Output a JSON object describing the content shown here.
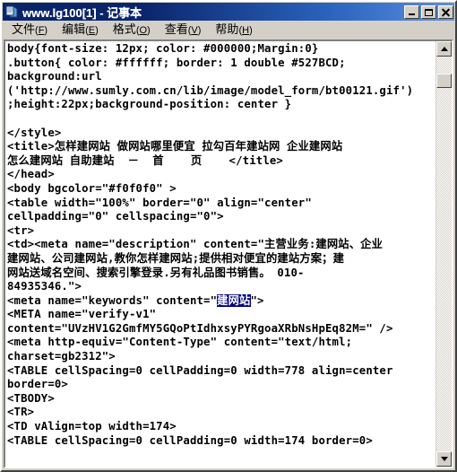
{
  "window": {
    "title": "www.lg100[1] - 记事本",
    "icon": "notepad-icon",
    "minimize_label": "最小化",
    "maximize_label": "最大化",
    "close_label": "关闭"
  },
  "menu": {
    "items": [
      {
        "label": "文件",
        "accel": "F"
      },
      {
        "label": "编辑",
        "accel": "E"
      },
      {
        "label": "格式",
        "accel": "O"
      },
      {
        "label": "查看",
        "accel": "V"
      },
      {
        "label": "帮助",
        "accel": "H"
      }
    ]
  },
  "editor": {
    "text_before_selection": "body{font-size: 12px; color: #000000;Margin:0}\n.button{ color: #ffffff; border: 1 double #527BCD;\nbackground:url\n('http://www.sumly.com.cn/lib/image/model_form/bt00121.gif')\n;height:22px;background-position: center }\n\n</style>\n<title>怎样建网站 做网站哪里便宜 拉勾百年建站网 企业建网站\n怎么建网站 自助建站  －  首    页    </title>\n</head>\n<body bgcolor=\"#f0f0f0\" >\n<table width=\"100%\" border=\"0\" align=\"center\"\ncellpadding=\"0\" cellspacing=\"0\">\n<tr>\n<td><meta name=\"description\" content=\"主营业务:建网站、企业\n建网站、公司建网站,教你怎样建网站;提供相对便宜的建站方案；建\n网站送域名空间、搜索引擎登录.另有礼品图书销售。 010-\n84935346.\">\n<meta name=\"keywords\" content=\"",
    "selected_text": "建网站",
    "text_after_selection": "\">\n<META name=\"verify-v1\"\ncontent=\"UVzHV1G2GmfMY5GQoPtIdhxsyPYRgoaXRbNsHpEq82M=\" />\n<meta http-equiv=\"Content-Type\" content=\"text/html;\ncharset=gb2312\">\n<TABLE cellSpacing=0 cellPadding=0 width=778 align=center\nborder=0>\n<TBODY>\n<TR>\n<TD vAlign=top width=174>\n<TABLE cellSpacing=0 cellPadding=0 width=174 border=0>"
  },
  "scrollbar": {
    "up_arrow": "scroll-up-arrow",
    "down_arrow": "scroll-down-arrow",
    "thumb": "scroll-thumb"
  },
  "colors": {
    "title_bar_start": "#0a246a",
    "title_bar_end": "#5a8fe0",
    "window_face": "#d4d0c8",
    "selection": "#000080",
    "text": "#000000",
    "editor_bg": "#ffffff"
  }
}
